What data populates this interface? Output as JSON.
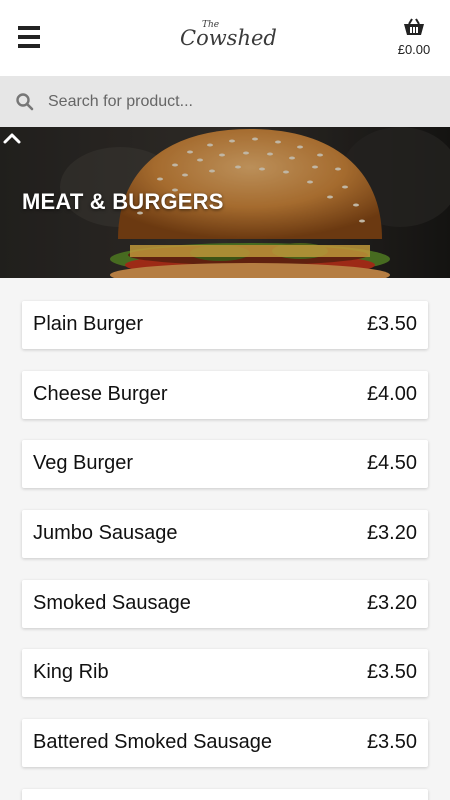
{
  "header": {
    "logo_top": "The",
    "logo_main": "Cowshed",
    "cart_total": "£0.00"
  },
  "search": {
    "placeholder": "Search for product..."
  },
  "category": {
    "title": "MEAT & BURGERS"
  },
  "products": [
    {
      "name": "Plain Burger",
      "price": "£3.50"
    },
    {
      "name": "Cheese Burger",
      "price": "£4.00"
    },
    {
      "name": "Veg Burger",
      "price": "£4.50"
    },
    {
      "name": "Jumbo Sausage",
      "price": "£3.20"
    },
    {
      "name": "Smoked Sausage",
      "price": "£3.20"
    },
    {
      "name": "King Rib",
      "price": "£3.50"
    },
    {
      "name": "Battered Smoked Sausage",
      "price": "£3.50"
    },
    {
      "name": "",
      "price": ""
    }
  ],
  "icons": {
    "menu": "hamburger-menu-icon",
    "cart": "basket-icon",
    "search": "search-icon",
    "collapse": "chevron-up-icon"
  }
}
